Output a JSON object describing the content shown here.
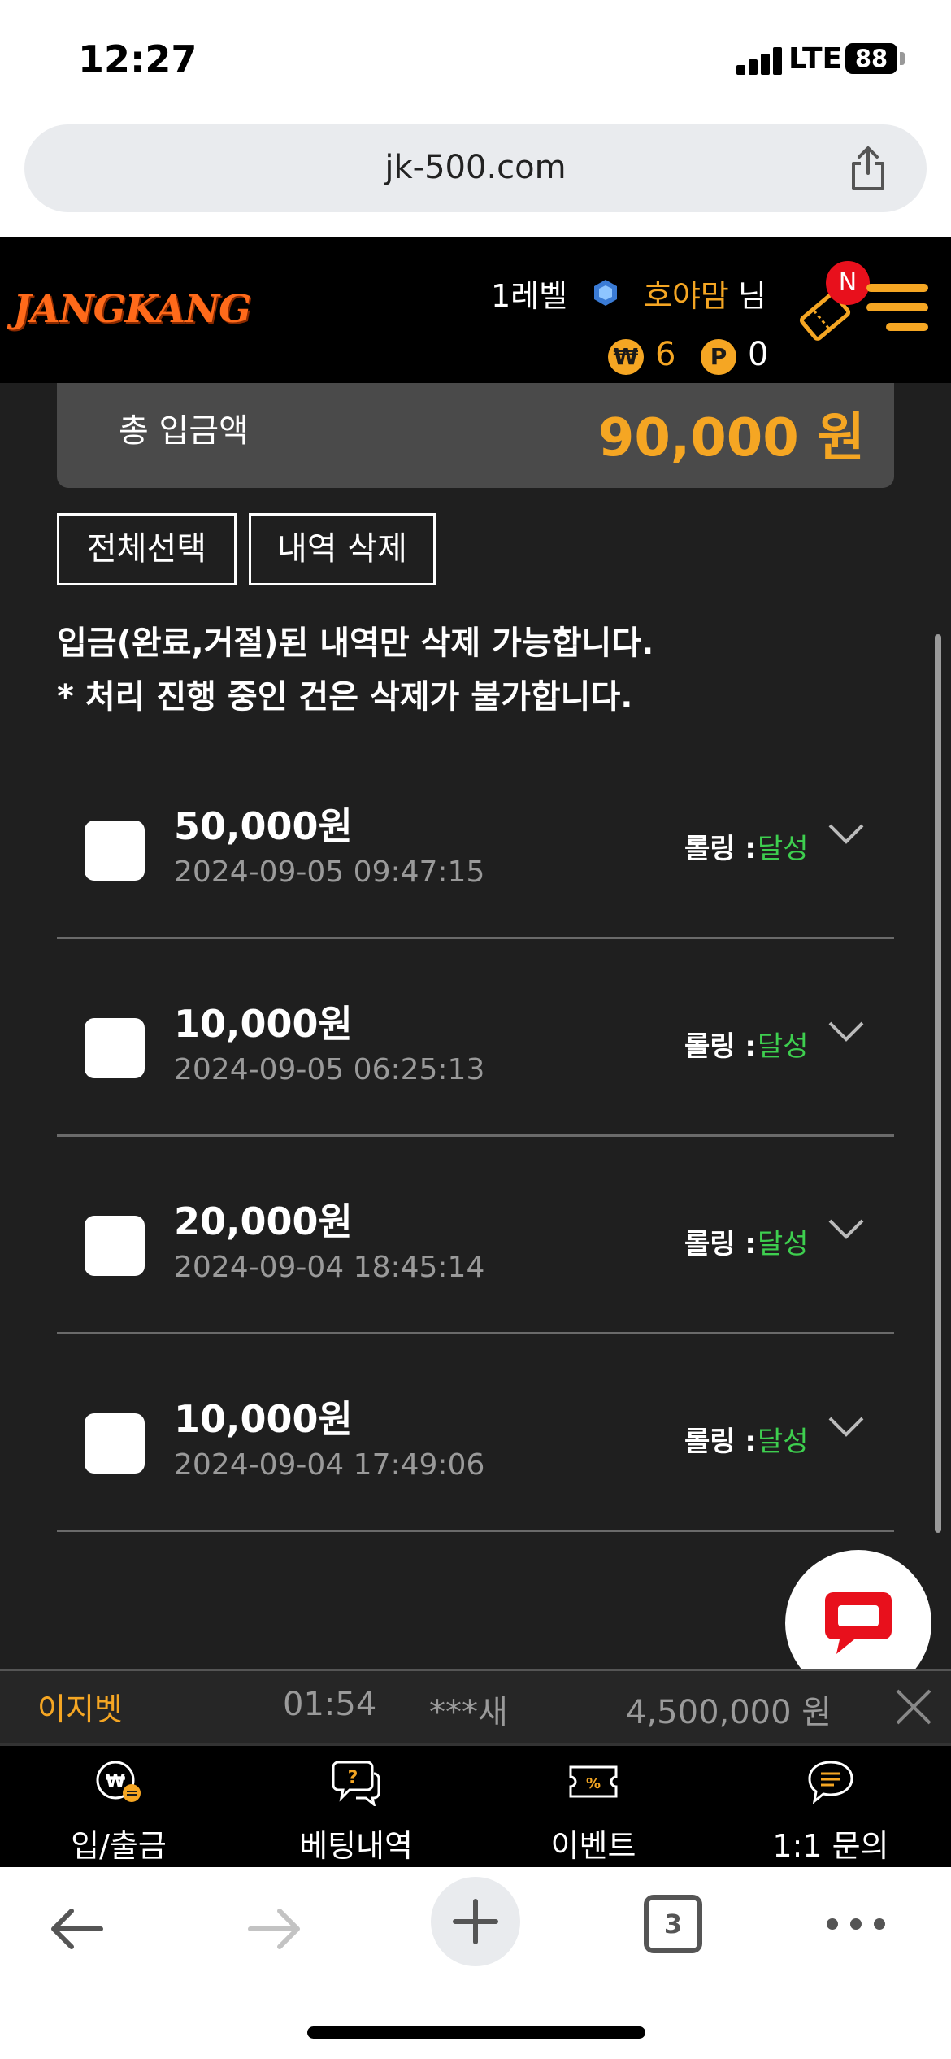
{
  "status_bar": {
    "time": "12:27",
    "network": "LTE",
    "battery": "88"
  },
  "browser": {
    "url": "jk-500.com",
    "tab_count": "3"
  },
  "header": {
    "logo": "JANGKANG",
    "level": "1레벨",
    "nickname": "호야맘",
    "honorific": "님",
    "won_symbol": "₩",
    "won_balance": "6",
    "point_symbol": "P",
    "point_balance": "0",
    "notification_badge": "N",
    "brand_color": "#f5a623"
  },
  "summary": {
    "label": "총 입금액",
    "amount": "90,000 원"
  },
  "actions": {
    "select_all": "전체선택",
    "delete_history": "내역 삭제"
  },
  "notice": {
    "line1": "입금(완료,거절)된 내역만 삭제 가능합니다.",
    "line2": "* 처리 진행 중인 건은 삭제가 불가합니다."
  },
  "deposits": [
    {
      "amount": "50,000원",
      "datetime": "2024-09-05 09:47:15",
      "rolling_label": "롤링 :",
      "rolling_status": "달성"
    },
    {
      "amount": "10,000원",
      "datetime": "2024-09-05 06:25:13",
      "rolling_label": "롤링 :",
      "rolling_status": "달성"
    },
    {
      "amount": "20,000원",
      "datetime": "2024-09-04 18:45:14",
      "rolling_label": "롤링 :",
      "rolling_status": "달성"
    },
    {
      "amount": "10,000원",
      "datetime": "2024-09-04 17:49:06",
      "rolling_label": "롤링 :",
      "rolling_status": "달성"
    }
  ],
  "ticker": {
    "site": "이지벳",
    "time": "01:54",
    "user": "***새",
    "amount": "4,500,000 원"
  },
  "bottom_nav": [
    {
      "label": "입/출금",
      "icon": "deposit-withdraw-icon"
    },
    {
      "label": "베팅내역",
      "icon": "betting-history-icon"
    },
    {
      "label": "이벤트",
      "icon": "event-ticket-icon"
    },
    {
      "label": "1:1 문의",
      "icon": "inquiry-chat-icon"
    }
  ]
}
